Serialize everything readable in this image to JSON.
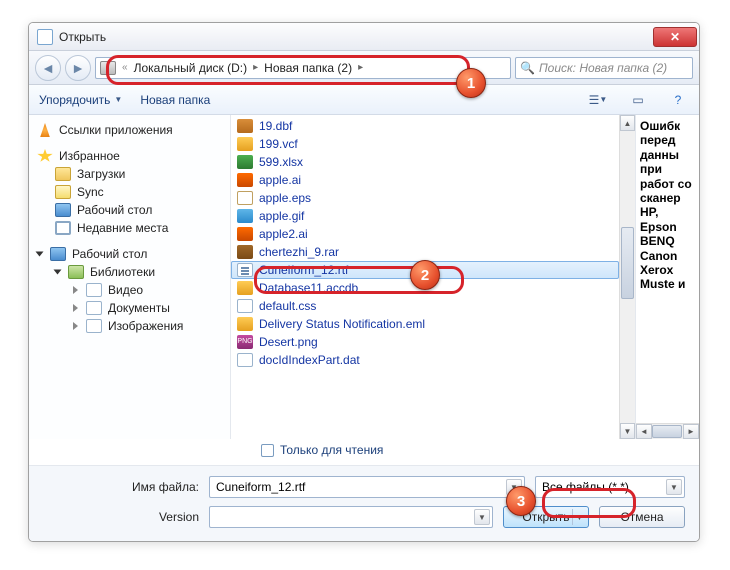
{
  "window": {
    "title": "Открыть"
  },
  "breadcrumb": {
    "disk": "Локальный диск (D:)",
    "folder": "Новая папка (2)"
  },
  "search": {
    "placeholder": "Поиск: Новая папка (2)"
  },
  "toolbar": {
    "organize": "Упорядочить",
    "newfolder": "Новая папка"
  },
  "sidebar": {
    "applinks": "Ссылки приложения",
    "fav": "Избранное",
    "downloads": "Загрузки",
    "sync": "Sync",
    "desktop": "Рабочий стол",
    "recent": "Недавние места",
    "desktop2": "Рабочий стол",
    "libs": "Библиотеки",
    "video": "Видео",
    "docs": "Документы",
    "pics": "Изображения"
  },
  "files": [
    {
      "name": "19.dbf",
      "icon": "fi-dbf"
    },
    {
      "name": "199.vcf",
      "icon": "fi-vcf"
    },
    {
      "name": "599.xlsx",
      "icon": "fi-xls"
    },
    {
      "name": "apple.ai",
      "icon": "fi-ai"
    },
    {
      "name": "apple.eps",
      "icon": "fi-eps"
    },
    {
      "name": "apple.gif",
      "icon": "fi-gif"
    },
    {
      "name": "apple2.ai",
      "icon": "fi-ai"
    },
    {
      "name": "chertezhi_9.rar",
      "icon": "fi-rar"
    },
    {
      "name": "Cuneiform_12.rtf",
      "icon": "fi-rtf",
      "selected": true
    },
    {
      "name": "Database11.accdb",
      "icon": "fi-acc"
    },
    {
      "name": "default.css",
      "icon": "fi-css"
    },
    {
      "name": "Delivery Status Notification.eml",
      "icon": "fi-eml"
    },
    {
      "name": "Desert.png",
      "icon": "fi-png"
    },
    {
      "name": "docIdIndexPart.dat",
      "icon": "fi-dat"
    }
  ],
  "preview": "Ошибк перед данны при работ со сканер HP, Epson BENQ Canon Xerox Muste и",
  "readonly_label": "Только для чтения",
  "bottom": {
    "filename_label": "Имя файла:",
    "filename_value": "Cuneiform_12.rtf",
    "filter": "Все файлы (*.*)",
    "version_label": "Version",
    "open": "Открыть",
    "cancel": "Отмена"
  },
  "badges": {
    "b1": "1",
    "b2": "2",
    "b3": "3"
  }
}
